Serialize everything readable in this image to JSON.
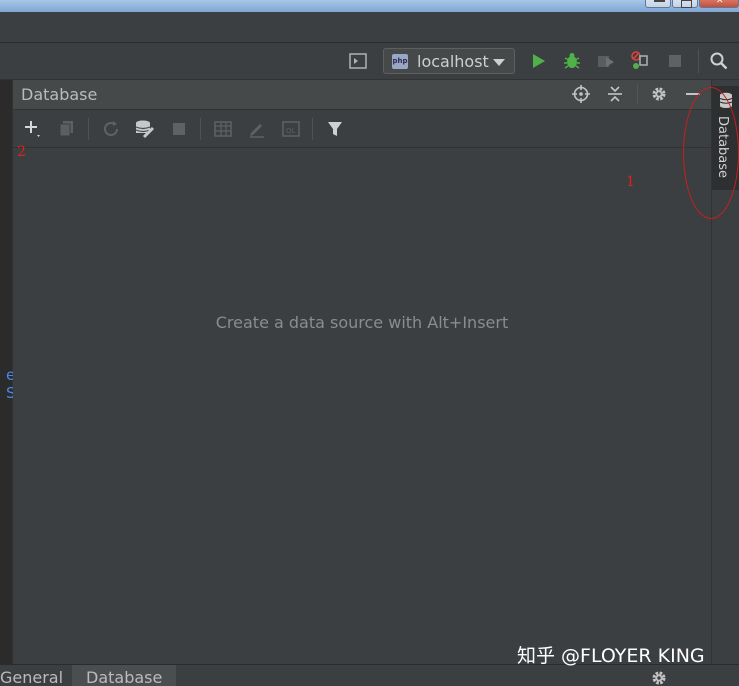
{
  "toolbar": {
    "run_config": "localhost",
    "colors": {
      "run": "#4fb14a",
      "debug": "#4fb14a"
    }
  },
  "panel": {
    "title": "Database",
    "empty_message": "Create a data source with Alt+Insert"
  },
  "right_strip": {
    "tab_label": "Database"
  },
  "annotations": {
    "a1": "1",
    "a2": "2"
  },
  "bottom_tabs": [
    {
      "label": "General",
      "active": false
    },
    {
      "label": "Database",
      "active": true
    }
  ],
  "editor_fragment": "e S",
  "watermark": "知乎 @FLOYER KING",
  "icons": [
    "terminal-icon",
    "php-icon",
    "run-icon",
    "debug-icon",
    "coverage-icon",
    "profile-icon",
    "stop-icon",
    "search-icon",
    "locate-icon",
    "collapse-icon",
    "gear-icon",
    "minimize-icon",
    "add-icon",
    "duplicate-icon",
    "refresh-icon",
    "properties-icon",
    "stop-icon",
    "table-icon",
    "edit-icon",
    "console-icon",
    "filter-icon",
    "database-icon"
  ]
}
